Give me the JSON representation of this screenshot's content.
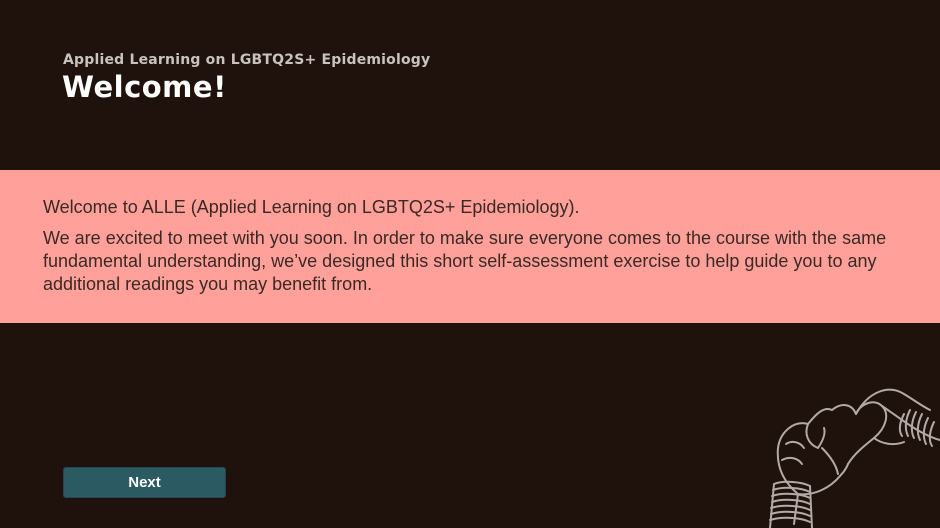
{
  "header": {
    "subtitle": "Applied Learning on LGBTQ2S+ Epidemiology",
    "title": "Welcome!"
  },
  "banner": {
    "intro": "Welcome to ALLE (Applied Learning on LGBTQ2S+ Epidemiology).",
    "body": "We are excited to meet with you soon.  In order to make sure everyone comes to the course with the same fundamental understanding, we’ve designed this short self-assessment exercise to help guide you to any additional readings you may benefit from."
  },
  "navigation": {
    "next_label": "Next"
  },
  "colors": {
    "background": "#1f120d",
    "banner": "#ffa19a",
    "button": "#2c5a63"
  },
  "decoration": {
    "icon": "heart-hands-icon"
  }
}
